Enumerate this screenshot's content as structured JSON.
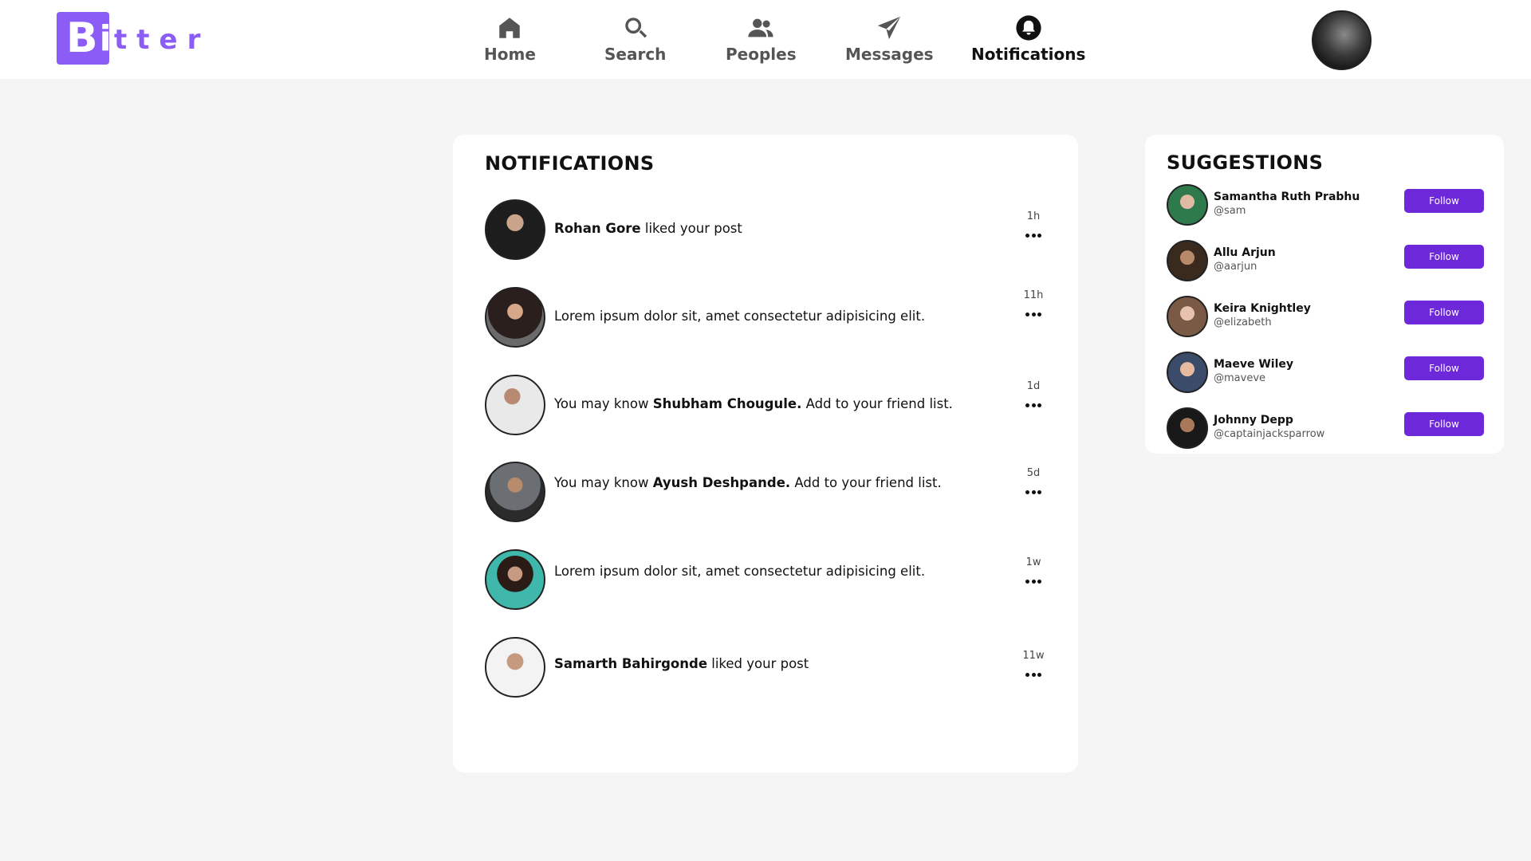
{
  "brand": {
    "logo_letter": "B",
    "logo_letter2": "i",
    "logo_rest": "tter",
    "color": "#8b5cf6"
  },
  "nav": {
    "items": [
      {
        "label": "Home",
        "icon": "home-icon",
        "active": false
      },
      {
        "label": "Search",
        "icon": "search-icon",
        "active": false
      },
      {
        "label": "Peoples",
        "icon": "people-icon",
        "active": false
      },
      {
        "label": "Messages",
        "icon": "paper-plane-icon",
        "active": false
      },
      {
        "label": "Notifications",
        "icon": "bell-icon",
        "active": true
      }
    ]
  },
  "notifications": {
    "title": "NOTIFICATIONS",
    "items": [
      {
        "name": "Rohan Gore",
        "pre": "",
        "post": " liked your post",
        "time": "1h"
      },
      {
        "name": "",
        "pre": "Lorem ipsum dolor sit, amet consectetur adipisicing elit.",
        "post": "",
        "time": "11h"
      },
      {
        "name": "Shubham Chougule.",
        "pre": "You may know ",
        "post": " Add to your friend list.",
        "time": "1d"
      },
      {
        "name": "Ayush Deshpande.",
        "pre": "You may know ",
        "post": " Add to your friend list.",
        "time": "5d"
      },
      {
        "name": "",
        "pre": "Lorem ipsum dolor sit, amet consectetur adipisicing elit.",
        "post": "",
        "time": "1w"
      },
      {
        "name": "Samarth Bahirgonde",
        "pre": "",
        "post": " liked your post",
        "time": "11w"
      }
    ]
  },
  "suggestions": {
    "title": "SUGGESTIONS",
    "button_label": "Follow",
    "button_color": "#6d28d9",
    "items": [
      {
        "name": "Samantha Ruth Prabhu",
        "handle": "@sam"
      },
      {
        "name": "Allu Arjun",
        "handle": "@aarjun"
      },
      {
        "name": "Keira Knightley",
        "handle": "@elizabeth"
      },
      {
        "name": "Maeve Wiley",
        "handle": "@maveve"
      },
      {
        "name": "Johnny Depp",
        "handle": "@captainjacksparrow"
      }
    ]
  }
}
